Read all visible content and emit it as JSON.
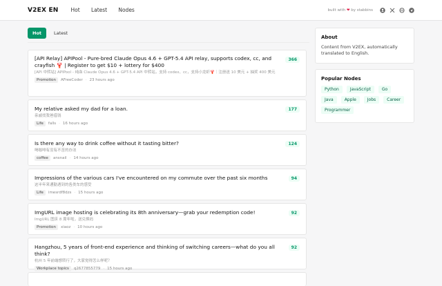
{
  "header": {
    "brand": "V2EX EN",
    "nav": [
      "Hot",
      "Latest",
      "Nodes"
    ],
    "built_with_prefix": "built with",
    "built_with_suffix": "by stabbins",
    "icons": [
      "github-icon",
      "x-icon",
      "globe-icon",
      "telegram-icon"
    ]
  },
  "tabs": [
    {
      "label": "Hot",
      "active": true
    },
    {
      "label": "Latest",
      "active": false
    }
  ],
  "posts": [
    {
      "title": "[API Relay] APIPool - Pure-bred Claude Opus 4.6 + GPT-5.4 API relay, supports codex, cc, and crayfish 🦞 | Register to get $10 + lottery for $400",
      "original": "[API 中转站] APIPool - 纯血 Claude Opus 4.6 + GPT-5.4 API 中转站，支持 codex、cc，支持小龙虾🦞｜注册送 10 美元 + 抽奖 400 美元",
      "node": "Promotion",
      "author": "AFreeCoder",
      "time": "23 hours ago",
      "replies": "366"
    },
    {
      "title": "My relative asked my dad for a loan.",
      "original": "亲戚找我爸借钱",
      "node": "Life",
      "author": "falls",
      "time": "16 hours ago",
      "replies": "177"
    },
    {
      "title": "Is there any way to drink coffee without it tasting bitter?",
      "original": "喝咖啡有没有不苦的办法",
      "node": "coffee",
      "author": "ansnail",
      "time": "14 hours ago",
      "replies": "124"
    },
    {
      "title": "Impressions of the various cars I've encountered on my commute over the past six months",
      "original": "这半年来通勤遇到的各类车的感受",
      "node": "Life",
      "author": "imesrdf8dzs",
      "time": "15 hours ago",
      "replies": "94"
    },
    {
      "title": "ImgURL image hosting is celebrating its 8th anniversary—grab your redemption code!",
      "original": "ImgURL 图床 8 周年啦，送兑换码",
      "node": "Promotion",
      "author": "xiaoz",
      "time": "10 hours ago",
      "replies": "92"
    },
    {
      "title": "Hangzhou, 5 years of front-end experience and thinking of switching careers—what do you all think?",
      "original": "杭州 5 年前端想转行了，大家觉得怎么样呢？",
      "node": "Workplace topics",
      "author": "q2677855779",
      "time": "15 hours ago",
      "replies": "92"
    }
  ],
  "about": {
    "title": "About",
    "text": "Content from V2EX, automatically translated to English."
  },
  "popular": {
    "title": "Popular Nodes",
    "nodes": [
      "Python",
      "JavaScript",
      "Go",
      "Java",
      "Apple",
      "Jobs",
      "Career",
      "Programmer"
    ]
  },
  "colors": {
    "accent": "#059669",
    "heart": "#e11d48"
  }
}
